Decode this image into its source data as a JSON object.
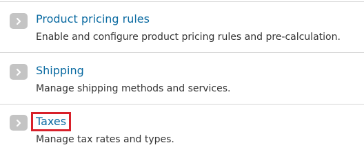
{
  "items": [
    {
      "title": "Product pricing rules",
      "description": "Enable and configure product pricing rules and pre-calculation.",
      "highlighted": false
    },
    {
      "title": "Shipping",
      "description": "Manage shipping methods and services.",
      "highlighted": false
    },
    {
      "title": "Taxes",
      "description": "Manage tax rates and types.",
      "highlighted": true
    }
  ],
  "colors": {
    "link": "#0a6aa1",
    "description": "#333333",
    "button_bg": "#c4c4c4",
    "divider": "#d4d4d4",
    "highlight_box": "#d8202a"
  },
  "icons": {
    "expand": "chevron-right-icon"
  }
}
